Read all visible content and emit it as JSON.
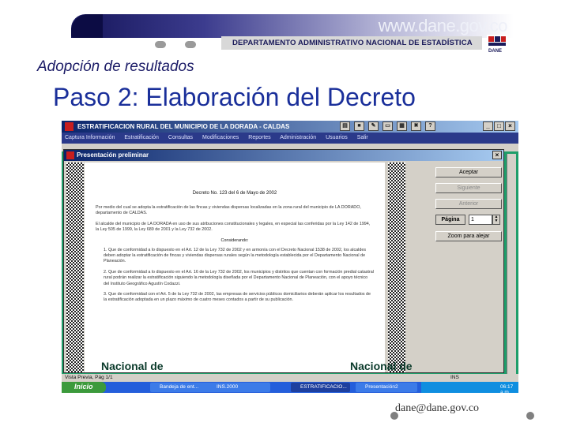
{
  "header": {
    "url": "www.dane.gov.co",
    "department": "DEPARTAMENTO ADMINISTRATIVO NACIONAL DE ESTADÍSTICA",
    "logo_text": "DANE"
  },
  "slide": {
    "subtitle": "Adopción de resultados",
    "title": "Paso 2: Elaboración del Decreto"
  },
  "app": {
    "title": "ESTRATIFICACION RURAL DEL MUNICIPIO DE LA DORADA - CALDAS",
    "menu": [
      "Captura Información",
      "Estratificación",
      "Consultas",
      "Modificaciones",
      "Reportes",
      "Administración",
      "Usuarios",
      "Salir"
    ]
  },
  "dialog": {
    "title": "Presentación preliminar",
    "close": "×",
    "buttons": {
      "accept": "Aceptar",
      "next": "Siguiente",
      "prev": "Anterior",
      "page_label": "Página",
      "page_value": "1",
      "zoom_out": "Zoom para alejar"
    }
  },
  "document": {
    "heading": "Decreto No. 123   del  6 de Mayo de 2002",
    "para1": "Por medio del cual se adopta la estratificación de las fincas y viviendas dispersas localizadas en la zona rural del municipio de LA DORADO, departamento de CALDAS.",
    "para2": "El alcalde del municipio de LA DORADA en uso de sus atribuciones constitucionales y legales, en especial las conferidas por la Ley 142 de 1994, la Ley 505 de 1999, la Ley 689 de 2001 y la Ley 732 de 2002.",
    "considering": "Considerando:",
    "item1": "1. Que de conformidad a lo dispuesto en el Art. 12 de la Ley 732 de 2002 y en armonía con el Decreto Nacional 1538 de 2002, los alcaldes deben adoptar la estratificación de fincas y viviendas dispersas rurales según la metodología establecida por el Departamento Nacional de Planeación.",
    "item2": "2. Que de conformidad a lo dispuesto en el Art. 16 de la Ley 732 de 2002, los municipios y distritos que cuentan con formación predial catastral rural podrán realizar la estratificación siguiendo la metodología diseñada por el Departamento Nacional de Planeación, con el apoyo técnico del Instituto Geográfico Agustín Codazzi.",
    "item3": "3. Que de conformidad con el Art. 5 de la Ley 732 de 2002, las empresas de servicios públicos domiciliarios deberán aplicar los resultados de la estratificación adoptada en un plazo máximo de cuatro meses contados a partir de su publicación."
  },
  "background_text": [
    "Nacional de",
    "Nacional de"
  ],
  "statusbar": {
    "text": "Vista Previa, Pág 1/1",
    "ins": "INS"
  },
  "taskbar": {
    "start": "Inicio",
    "items": [
      "Bandeja de ent...",
      "INS.2000",
      "ESTRATIFICACIO...",
      "Presentación2"
    ],
    "clock": "06:17 a.m."
  },
  "footer": {
    "email": "dane@dane.gov.co"
  }
}
